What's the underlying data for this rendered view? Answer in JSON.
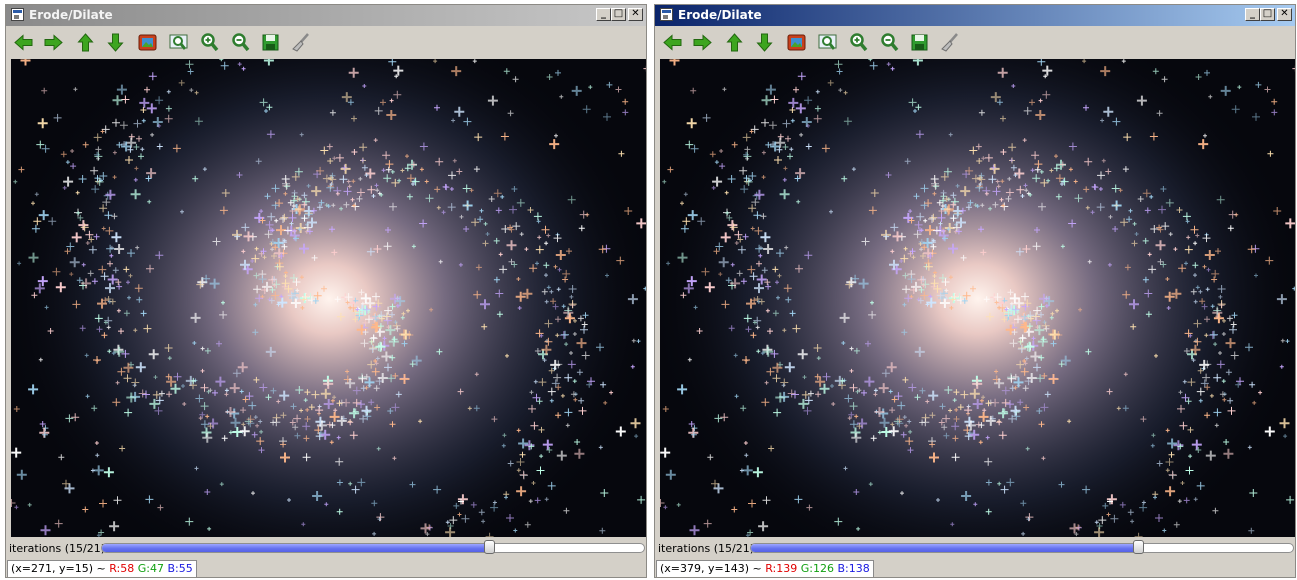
{
  "windows": [
    {
      "title": "Erode/Dilate",
      "state": "inactive",
      "trackbar": {
        "label": "iterations (15/21)",
        "value": 15,
        "max": 21
      },
      "status": {
        "coords": "(x=271, y=15)",
        "sep": " ~ ",
        "r": "R:58",
        "g": "G:47",
        "b": "B:55"
      }
    },
    {
      "title": "Erode/Dilate",
      "state": "active",
      "trackbar": {
        "label": "iterations (15/21)",
        "value": 15,
        "max": 21
      },
      "status": {
        "coords": "(x=379, y=143)",
        "sep": " ~ ",
        "r": "R:139",
        "g": "G:126",
        "b": "B:138"
      }
    }
  ],
  "caption_buttons": {
    "minimize": "_",
    "maximize": "□",
    "close": "✕"
  },
  "toolbar_icons": [
    "arrow-left-icon",
    "arrow-right-icon",
    "arrow-up-icon",
    "arrow-down-icon",
    "image-icon",
    "zoom-fit-icon",
    "zoom-in-icon",
    "zoom-out-icon",
    "save-icon",
    "brush-icon"
  ],
  "colors": {
    "accent": "#5561e6",
    "status_r": "#e00000",
    "status_g": "#12a012",
    "status_b": "#1a1ae0"
  }
}
